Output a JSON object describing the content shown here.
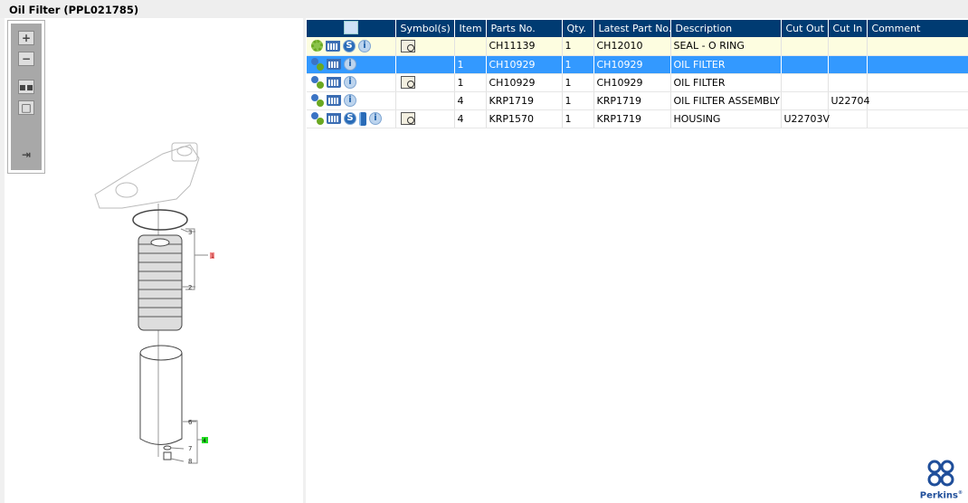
{
  "title": "Oil Filter (PPL021785)",
  "toolbar": [
    "zoom-in",
    "zoom-out",
    "fit-all",
    "fit-page",
    "export"
  ],
  "diagram": {
    "callouts": [
      "3",
      "2",
      "6",
      "7",
      "8"
    ],
    "highlights": [
      {
        "label": "1",
        "color": "#f28b8b"
      },
      {
        "label": "4",
        "color": "#22dd22"
      }
    ]
  },
  "table": {
    "headers": [
      "",
      "Symbol(s)",
      "Item",
      "Parts No.",
      "Qty.",
      "Latest Part No.",
      "Description",
      "Cut Out",
      "Cut In",
      "Comment"
    ],
    "rows": [
      {
        "icons": [
          "gear",
          "cart",
          "s",
          "info"
        ],
        "symbol": true,
        "item": "",
        "part": "CH11139",
        "qty": "1",
        "latest": "CH12010",
        "desc": "SEAL - O RING",
        "cutout": "",
        "cutin": "",
        "comment": ""
      },
      {
        "icons": [
          "gears",
          "cart",
          "info"
        ],
        "symbol": false,
        "item": "1",
        "part": "CH10929",
        "qty": "1",
        "latest": "CH10929",
        "desc": "OIL FILTER",
        "cutout": "",
        "cutin": "",
        "comment": ""
      },
      {
        "icons": [
          "gears",
          "cart",
          "info"
        ],
        "symbol": true,
        "item": "1",
        "part": "CH10929",
        "qty": "1",
        "latest": "CH10929",
        "desc": "OIL FILTER",
        "cutout": "",
        "cutin": "",
        "comment": ""
      },
      {
        "icons": [
          "gears",
          "cart",
          "info"
        ],
        "symbol": false,
        "item": "4",
        "part": "KRP1719",
        "qty": "1",
        "latest": "KRP1719",
        "desc": "OIL FILTER ASSEMBLY",
        "cutout": "",
        "cutin": "U22704",
        "comment": ""
      },
      {
        "icons": [
          "gears",
          "cart",
          "s",
          "book",
          "info"
        ],
        "symbol": true,
        "item": "4",
        "part": "KRP1570",
        "qty": "1",
        "latest": "KRP1719",
        "desc": "HOUSING",
        "cutout": "U22703V",
        "cutin": "",
        "comment": ""
      }
    ]
  },
  "logo": "Perkins",
  "colors": {
    "header": "#003b72",
    "selected": "#3399ff",
    "highlight_row": "#fdfde0"
  }
}
